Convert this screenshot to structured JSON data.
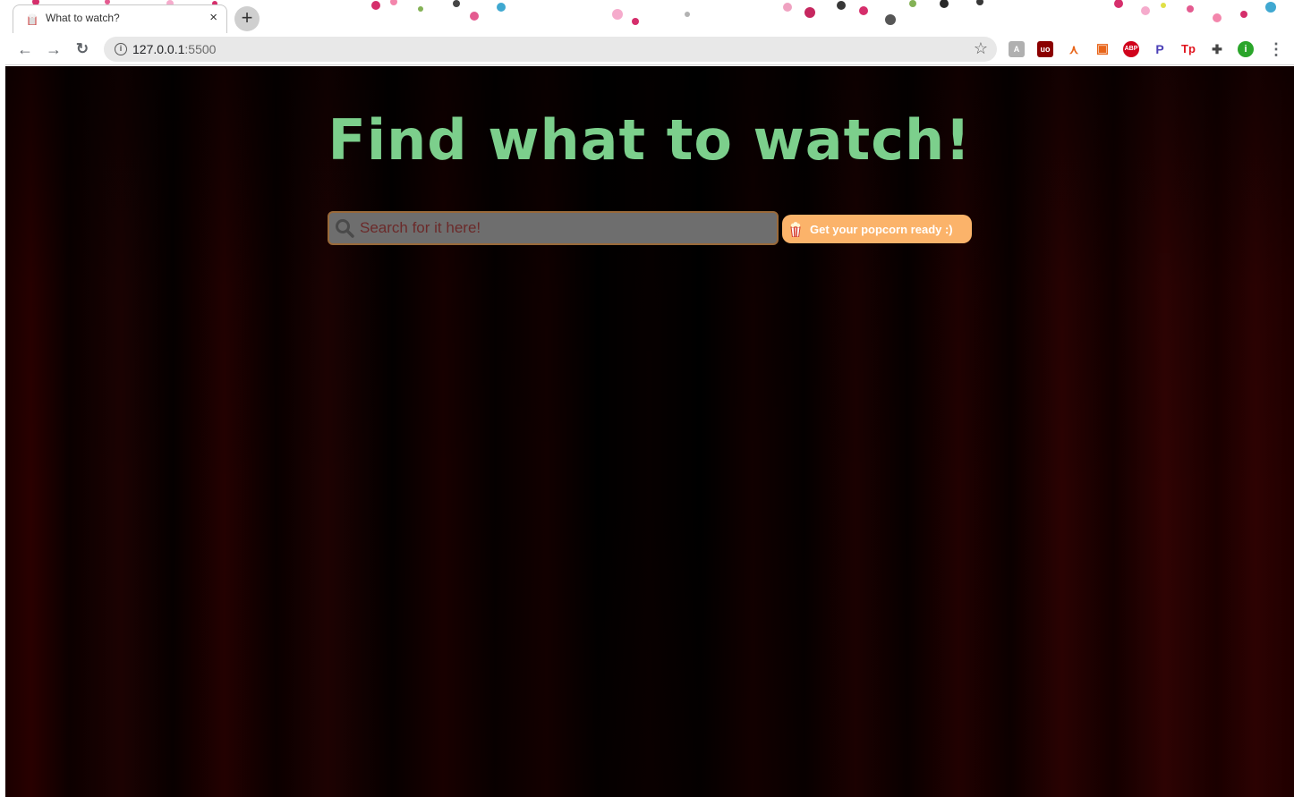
{
  "browser": {
    "tab_title": "What to watch?",
    "tab_close": "×",
    "new_tab": "+",
    "url_host": "127.0.0.1",
    "url_port": ":5500",
    "extensions": [
      {
        "name": "translate-ext",
        "label": "A"
      },
      {
        "name": "ublock-ext",
        "label": "uo"
      },
      {
        "name": "orange-ext",
        "label": "⋏"
      },
      {
        "name": "grid-ext",
        "label": "▣"
      },
      {
        "name": "adblock-ext",
        "label": "ABP"
      },
      {
        "name": "p-ext",
        "label": "P"
      },
      {
        "name": "tp-ext",
        "label": "Tp"
      },
      {
        "name": "puzzle-ext",
        "label": "✚"
      },
      {
        "name": "profile-ext",
        "label": "i"
      }
    ]
  },
  "page": {
    "headline": "Find what to watch!",
    "search_placeholder": "Search for it here!",
    "search_value": "",
    "button_label": "Get your popcorn ready :)"
  },
  "colors": {
    "headline": "#7ccf8c",
    "button_bg": "#fbb36a",
    "background": "#1a0000"
  }
}
